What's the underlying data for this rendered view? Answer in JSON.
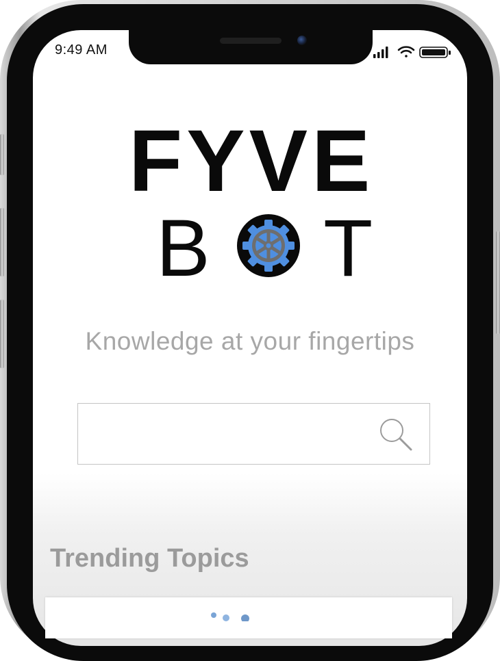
{
  "status_bar": {
    "time": "9:49 AM"
  },
  "logo": {
    "line1": "FYVE",
    "line2_left": "B",
    "line2_right": "T"
  },
  "tagline": "Knowledge at your fingertips",
  "search": {
    "value": "",
    "placeholder": ""
  },
  "trending": {
    "title": "Trending Topics"
  },
  "colors": {
    "gear_blue": "#4f8fe0",
    "gear_gray": "#6e6e6e",
    "tagline_gray": "#a7a7a7",
    "heading_gray": "#9b9b9b"
  },
  "icons": [
    "signal-icon",
    "wifi-icon",
    "battery-icon",
    "gear-icon",
    "search-icon"
  ]
}
